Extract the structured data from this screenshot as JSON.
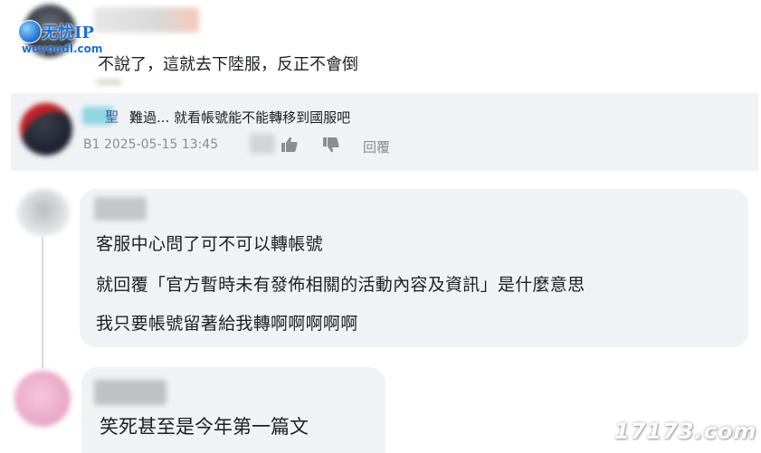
{
  "watermark": {
    "brand": "无忧IP",
    "url": "wuyoudl.com",
    "corner": "17173.com"
  },
  "comments": {
    "top": {
      "text": "不說了，這就去下陸服，反正不會倒"
    },
    "reply": {
      "name_fragment": "聖",
      "text": "難過... 就看帳號能不能轉移到國服吧",
      "meta": "B1  2025-05-15 13:45",
      "reply_label": "回覆"
    },
    "second": {
      "lines": [
        "客服中心問了可不可以轉帳號",
        "就回覆「官方暫時未有發佈相關的活動內容及資訊」是什麼意思",
        "我只要帳號留著給我轉啊啊啊啊啊"
      ]
    },
    "third": {
      "text": "笑死甚至是今年第一篇文"
    }
  },
  "colors": {
    "bubble": "#f0f2f5",
    "link_name": "#3a5aa8",
    "meta_gray": "#8a8d91",
    "watermark_blue": "#1b6fd8"
  },
  "icons": [
    "thumbs-up-icon",
    "thumbs-down-icon",
    "globe-icon"
  ]
}
